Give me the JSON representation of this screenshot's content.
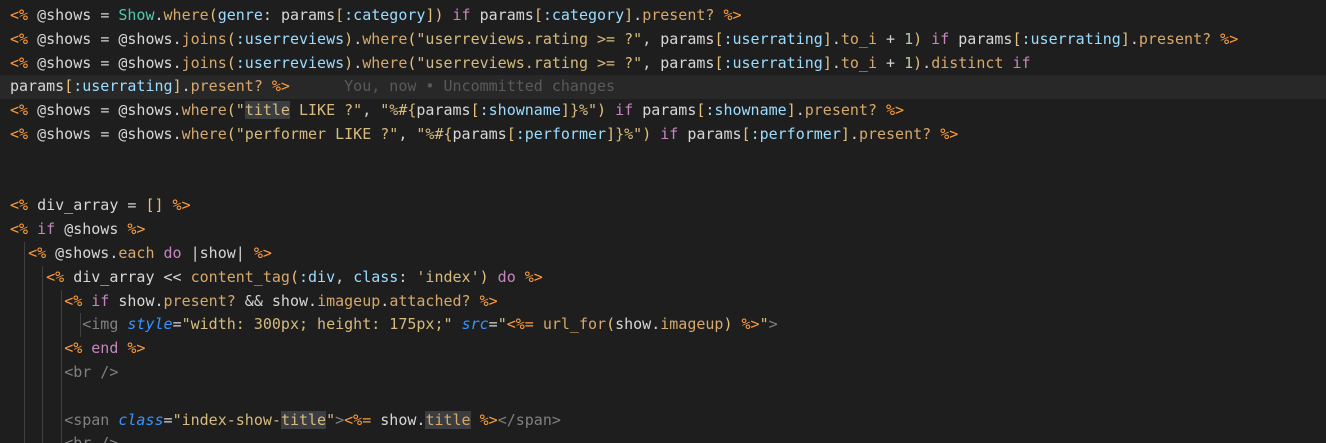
{
  "editor": {
    "blame": "You, now • Uncommitted changes",
    "lines": [
      [
        [
          "tag",
          "<%"
        ],
        [
          "var",
          " @shows "
        ],
        [
          "op",
          "= "
        ],
        [
          "cls",
          "Show"
        ],
        [
          "op",
          "."
        ],
        [
          "fn",
          "where"
        ],
        [
          "paren",
          "("
        ],
        [
          "sym",
          "genre"
        ],
        [
          "op",
          ": "
        ],
        [
          "var",
          "params"
        ],
        [
          "paren",
          "["
        ],
        [
          "sym",
          ":category"
        ],
        [
          "paren",
          "]"
        ],
        [
          "paren",
          ")"
        ],
        [
          "kw",
          " if "
        ],
        [
          "var",
          "params"
        ],
        [
          "paren",
          "["
        ],
        [
          "sym",
          ":category"
        ],
        [
          "paren",
          "]"
        ],
        [
          "op",
          "."
        ],
        [
          "fn",
          "present?"
        ],
        [
          "tag",
          " %>"
        ]
      ],
      [
        [
          "tag",
          "<%"
        ],
        [
          "var",
          " @shows "
        ],
        [
          "op",
          "= "
        ],
        [
          "var",
          "@shows"
        ],
        [
          "op",
          "."
        ],
        [
          "fn",
          "joins"
        ],
        [
          "paren",
          "("
        ],
        [
          "sym",
          ":userreviews"
        ],
        [
          "paren",
          ")"
        ],
        [
          "op",
          "."
        ],
        [
          "fn",
          "where"
        ],
        [
          "paren",
          "("
        ],
        [
          "str",
          "\"userreviews.rating >= ?\""
        ],
        [
          "op",
          ", "
        ],
        [
          "var",
          "params"
        ],
        [
          "paren",
          "["
        ],
        [
          "sym",
          ":userrating"
        ],
        [
          "paren",
          "]"
        ],
        [
          "op",
          "."
        ],
        [
          "fn",
          "to_i"
        ],
        [
          "op",
          " + "
        ],
        [
          "num",
          "1"
        ],
        [
          "paren",
          ")"
        ],
        [
          "kw",
          " if "
        ],
        [
          "var",
          "params"
        ],
        [
          "paren",
          "["
        ],
        [
          "sym",
          ":userrating"
        ],
        [
          "paren",
          "]"
        ],
        [
          "op",
          "."
        ],
        [
          "fn",
          "present?"
        ],
        [
          "tag",
          " %>"
        ]
      ],
      [
        [
          "tag",
          "<%"
        ],
        [
          "var",
          " @shows "
        ],
        [
          "op",
          "= "
        ],
        [
          "var",
          "@shows"
        ],
        [
          "op",
          "."
        ],
        [
          "fn",
          "joins"
        ],
        [
          "paren",
          "("
        ],
        [
          "sym",
          ":userreviews"
        ],
        [
          "paren",
          ")"
        ],
        [
          "op",
          "."
        ],
        [
          "fn",
          "where"
        ],
        [
          "paren",
          "("
        ],
        [
          "str",
          "\"userreviews.rating >= ?\""
        ],
        [
          "op",
          ", "
        ],
        [
          "var",
          "params"
        ],
        [
          "paren",
          "["
        ],
        [
          "sym",
          ":userrating"
        ],
        [
          "paren",
          "]"
        ],
        [
          "op",
          "."
        ],
        [
          "fn",
          "to_i"
        ],
        [
          "op",
          " + "
        ],
        [
          "num",
          "1"
        ],
        [
          "paren",
          ")"
        ],
        [
          "op",
          "."
        ],
        [
          "fn",
          "distinct"
        ],
        [
          "kw",
          " if"
        ]
      ],
      [
        [
          "var",
          "params"
        ],
        [
          "paren",
          "["
        ],
        [
          "sym",
          ":userrating"
        ],
        [
          "paren",
          "]"
        ],
        [
          "op",
          "."
        ],
        [
          "fn",
          "present?"
        ],
        [
          "tag",
          " %>"
        ]
      ],
      [
        [
          "tag",
          "<%"
        ],
        [
          "var",
          " @shows "
        ],
        [
          "op",
          "= "
        ],
        [
          "var",
          "@shows"
        ],
        [
          "op",
          "."
        ],
        [
          "fn",
          "where"
        ],
        [
          "paren",
          "("
        ],
        [
          "str",
          "\""
        ],
        [
          "strhl",
          "title"
        ],
        [
          "str",
          " LIKE ?\""
        ],
        [
          "op",
          ", "
        ],
        [
          "str",
          "\"%#{"
        ],
        [
          "var",
          "params"
        ],
        [
          "paren",
          "["
        ],
        [
          "sym",
          ":showname"
        ],
        [
          "paren",
          "]"
        ],
        [
          "str",
          "}%\""
        ],
        [
          "paren",
          ")"
        ],
        [
          "kw",
          " if "
        ],
        [
          "var",
          "params"
        ],
        [
          "paren",
          "["
        ],
        [
          "sym",
          ":showname"
        ],
        [
          "paren",
          "]"
        ],
        [
          "op",
          "."
        ],
        [
          "fn",
          "present?"
        ],
        [
          "tag",
          " %>"
        ]
      ],
      [
        [
          "tag",
          "<%"
        ],
        [
          "var",
          " @shows "
        ],
        [
          "op",
          "= "
        ],
        [
          "var",
          "@shows"
        ],
        [
          "op",
          "."
        ],
        [
          "fn",
          "where"
        ],
        [
          "paren",
          "("
        ],
        [
          "str",
          "\"performer LIKE ?\""
        ],
        [
          "op",
          ", "
        ],
        [
          "str",
          "\"%#{"
        ],
        [
          "var",
          "params"
        ],
        [
          "paren",
          "["
        ],
        [
          "sym",
          ":performer"
        ],
        [
          "paren",
          "]"
        ],
        [
          "str",
          "}%\""
        ],
        [
          "paren",
          ")"
        ],
        [
          "kw",
          " if "
        ],
        [
          "var",
          "params"
        ],
        [
          "paren",
          "["
        ],
        [
          "sym",
          ":performer"
        ],
        [
          "paren",
          "]"
        ],
        [
          "op",
          "."
        ],
        [
          "fn",
          "present?"
        ],
        [
          "tag",
          " %>"
        ]
      ],
      [],
      [],
      [
        [
          "tag",
          "<%"
        ],
        [
          "var",
          " div_array "
        ],
        [
          "op",
          "= "
        ],
        [
          "paren",
          "[]"
        ],
        [
          "tag",
          " %>"
        ]
      ],
      [
        [
          "tag",
          "<%"
        ],
        [
          "kw",
          " if "
        ],
        [
          "var",
          "@shows"
        ],
        [
          "tag",
          " %>"
        ]
      ],
      [
        [
          "op",
          "  "
        ],
        [
          "tag",
          "<%"
        ],
        [
          "var",
          " @shows"
        ],
        [
          "op",
          "."
        ],
        [
          "fn",
          "each"
        ],
        [
          "kw",
          " do "
        ],
        [
          "op",
          "|"
        ],
        [
          "var",
          "show"
        ],
        [
          "op",
          "|"
        ],
        [
          "tag",
          " %>"
        ]
      ],
      [
        [
          "op",
          "    "
        ],
        [
          "tag",
          "<%"
        ],
        [
          "var",
          " div_array "
        ],
        [
          "op",
          "<< "
        ],
        [
          "fn",
          "content_tag"
        ],
        [
          "paren",
          "("
        ],
        [
          "sym",
          ":div"
        ],
        [
          "op",
          ", "
        ],
        [
          "sym",
          "class"
        ],
        [
          "op",
          ": "
        ],
        [
          "str",
          "'index'"
        ],
        [
          "paren",
          ")"
        ],
        [
          "kw",
          " do"
        ],
        [
          "tag",
          " %>"
        ]
      ],
      [
        [
          "op",
          "      "
        ],
        [
          "tag",
          "<%"
        ],
        [
          "kw",
          " if "
        ],
        [
          "var",
          "show"
        ],
        [
          "op",
          "."
        ],
        [
          "fn",
          "present?"
        ],
        [
          "op",
          " && "
        ],
        [
          "var",
          "show"
        ],
        [
          "op",
          "."
        ],
        [
          "fn",
          "imageup"
        ],
        [
          "op",
          "."
        ],
        [
          "fn",
          "attached?"
        ],
        [
          "tag",
          " %>"
        ]
      ],
      [
        [
          "op",
          "        "
        ],
        [
          "html",
          "<"
        ],
        [
          "html",
          "img "
        ],
        [
          "attr",
          "style"
        ],
        [
          "op",
          "="
        ],
        [
          "str",
          "\"width: 300px; height: 175px;\""
        ],
        [
          "op",
          " "
        ],
        [
          "attr",
          "src"
        ],
        [
          "op",
          "="
        ],
        [
          "str",
          "\""
        ],
        [
          "tag",
          "<%="
        ],
        [
          "fn",
          " url_for"
        ],
        [
          "paren",
          "("
        ],
        [
          "var",
          "show"
        ],
        [
          "op",
          "."
        ],
        [
          "fn",
          "imageup"
        ],
        [
          "paren",
          ")"
        ],
        [
          "tag",
          " %>"
        ],
        [
          "str",
          "\""
        ],
        [
          "html",
          ">"
        ]
      ],
      [
        [
          "op",
          "      "
        ],
        [
          "tag",
          "<%"
        ],
        [
          "kw",
          " end"
        ],
        [
          "tag",
          " %>"
        ]
      ],
      [
        [
          "op",
          "      "
        ],
        [
          "html",
          "<br />"
        ]
      ],
      [],
      [
        [
          "op",
          "      "
        ],
        [
          "html",
          "<"
        ],
        [
          "html",
          "span "
        ],
        [
          "attr",
          "class"
        ],
        [
          "op",
          "="
        ],
        [
          "str",
          "\"index-show-"
        ],
        [
          "strhl",
          "title"
        ],
        [
          "str",
          "\""
        ],
        [
          "html",
          ">"
        ],
        [
          "tag",
          "<%="
        ],
        [
          "var",
          " show"
        ],
        [
          "op",
          "."
        ],
        [
          "fnhl",
          "title"
        ],
        [
          "tag",
          " %>"
        ],
        [
          "html",
          "</span>"
        ]
      ],
      [
        [
          "op",
          "      "
        ],
        [
          "html",
          "<br />"
        ]
      ]
    ]
  }
}
